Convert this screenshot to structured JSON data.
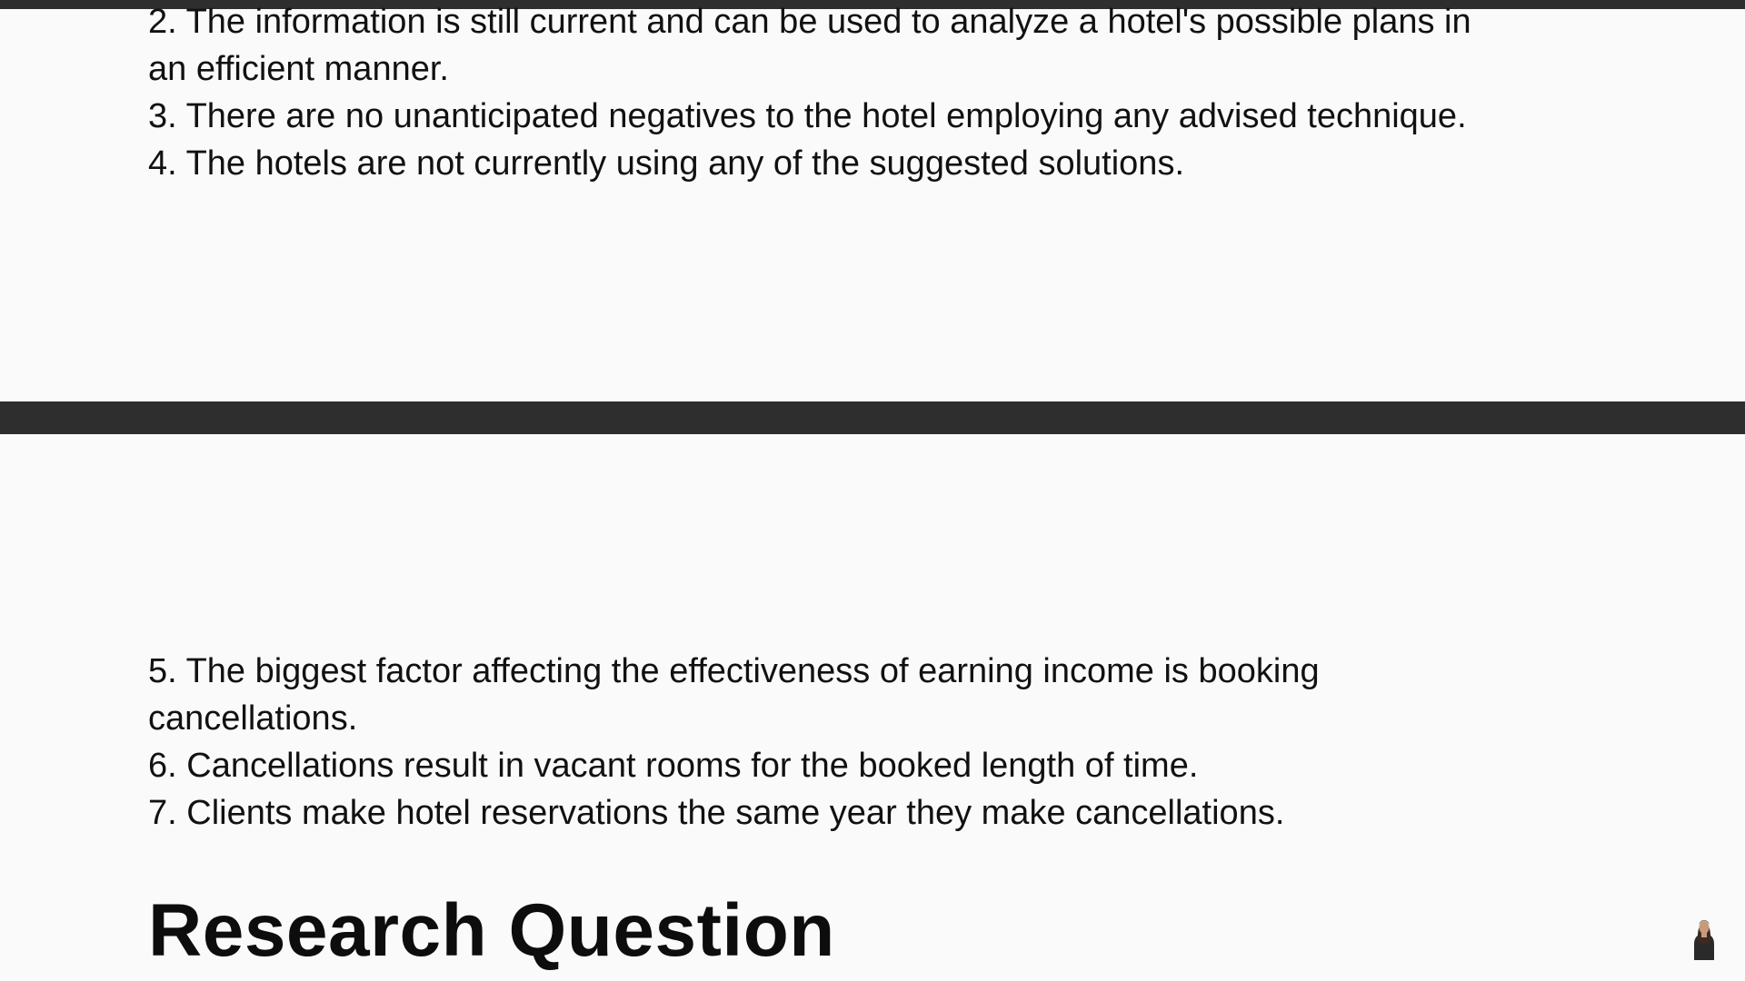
{
  "assumptions_top": [
    {
      "line1": "2. The information is still current and can be used to analyze a hotel's possible plans in",
      "line2": "an efficient manner."
    },
    {
      "line1": "3. There are no unanticipated negatives to the hotel employing any advised technique."
    },
    {
      "line1": "4. The hotels are not currently using any of the suggested solutions."
    }
  ],
  "assumptions_bottom": [
    {
      "line1": "5. The biggest factor affecting the effectiveness of earning income is booking",
      "line2": "cancellations."
    },
    {
      "line1": "6. Cancellations result in vacant rooms for the booked length of time."
    },
    {
      "line1": "7. Clients make hotel reservations the same year they make cancellations."
    }
  ],
  "section_heading": "Research Question",
  "icons": {
    "presenter": "presenter-thumbnail-icon"
  }
}
